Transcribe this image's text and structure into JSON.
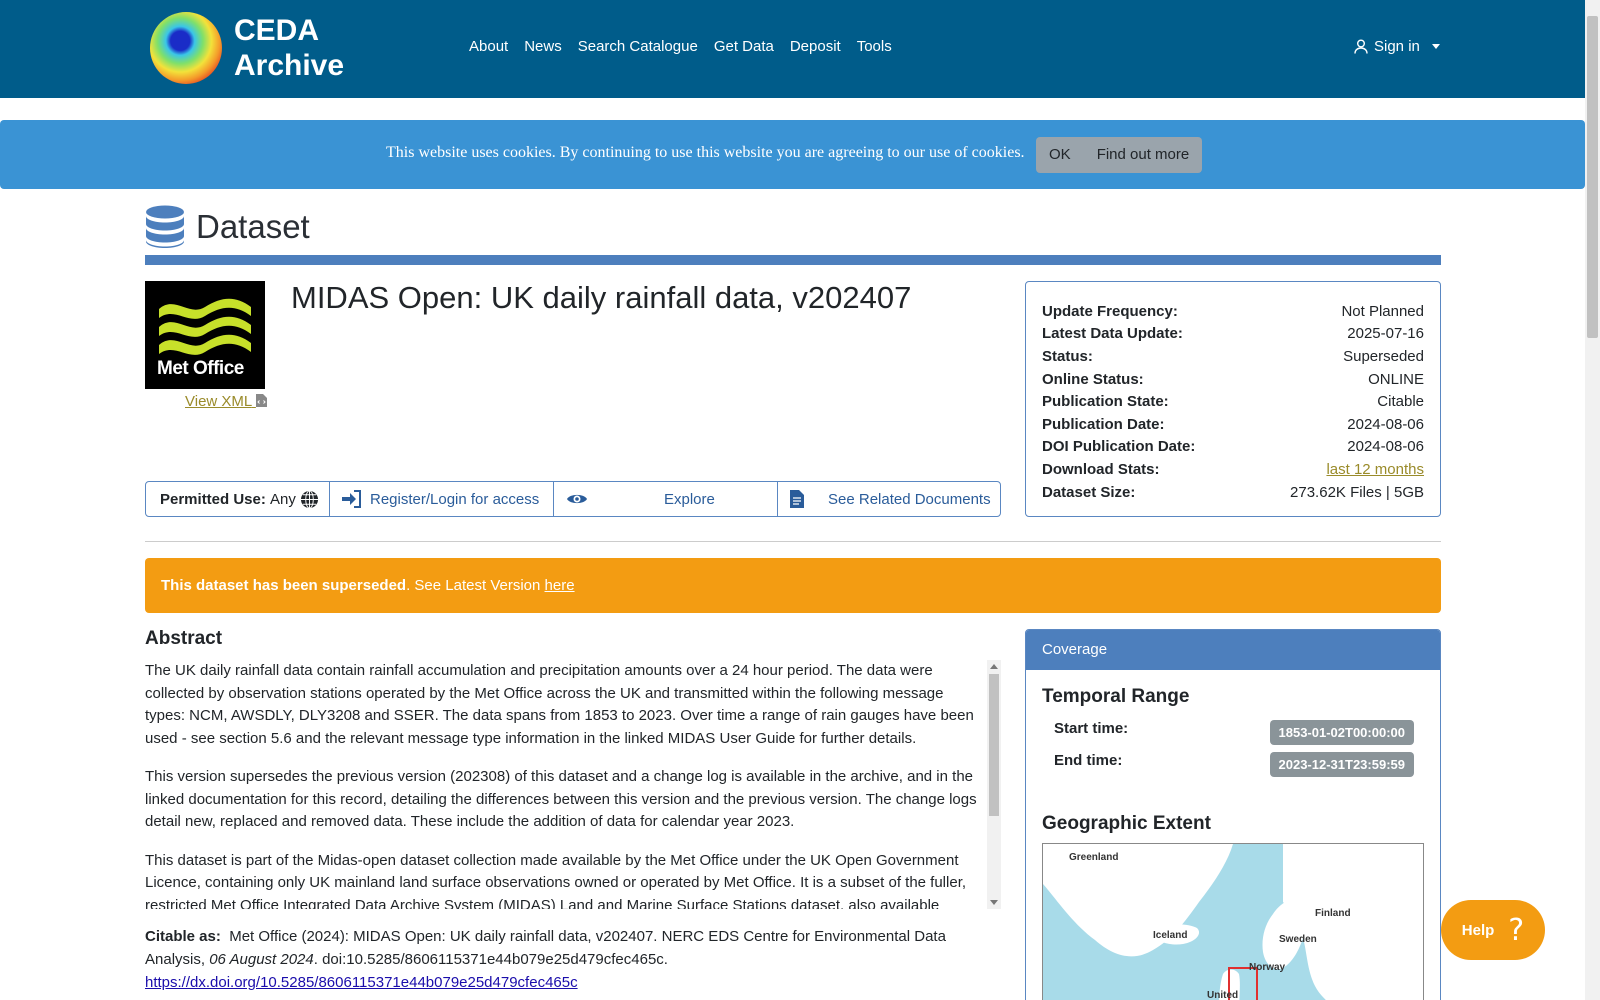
{
  "nav": {
    "brand_line1": "CEDA",
    "brand_line2": "Archive",
    "items": [
      "About",
      "News",
      "Search Catalogue",
      "Get Data",
      "Deposit",
      "Tools"
    ],
    "signin": "Sign in"
  },
  "cookie": {
    "text": "This website uses cookies. By continuing to use this website you are agreeing to our use of cookies.",
    "ok": "OK",
    "find_out": "Find out more"
  },
  "header": {
    "title": "Dataset"
  },
  "logo_text": "Met Office",
  "view_xml": "View XML",
  "dataset_title": "MIDAS Open: UK daily rainfall data, v202407",
  "actions": {
    "permitted_label": "Permitted Use:",
    "permitted_value": "Any",
    "register": "Register/Login for access",
    "explore": "Explore",
    "related": "See Related Documents"
  },
  "info": [
    {
      "k": "Update Frequency:",
      "v": "Not Planned"
    },
    {
      "k": "Latest Data Update:",
      "v": "2025-07-16"
    },
    {
      "k": "Status:",
      "v": "Superseded"
    },
    {
      "k": "Online Status:",
      "v": "ONLINE"
    },
    {
      "k": "Publication State:",
      "v": "Citable"
    },
    {
      "k": "Publication Date:",
      "v": "2024-08-06"
    },
    {
      "k": "DOI Publication Date:",
      "v": "2024-08-06"
    },
    {
      "k": "Download Stats:",
      "v": "last 12 months"
    },
    {
      "k": "Dataset Size:",
      "v": "273.62K Files | 5GB"
    }
  ],
  "warning": {
    "bold": "This dataset has been superseded",
    "rest": ". See Latest Version ",
    "link": "here"
  },
  "abstract": {
    "heading": "Abstract",
    "paragraphs": [
      "The UK daily rainfall data contain rainfall accumulation and precipitation amounts over a 24 hour period. The data were collected by observation stations operated by the Met Office across the UK and transmitted within the following message types: NCM, AWSDLY, DLY3208 and SSER. The data spans from 1853 to 2023. Over time a range of rain gauges have been used - see section 5.6 and the relevant message type information in the linked MIDAS User Guide for further details.",
      "This version supersedes the previous version (202308) of this dataset and a change log is available in the archive, and in the linked documentation for this record, detailing the differences between this version and the previous version. The change logs detail new, replaced and removed data. These include the addition of data for calendar year 2023.",
      "This dataset is part of the Midas-open dataset collection made available by the Met Office under the UK Open Government Licence, containing only UK mainland land surface observations owned or operated by Met Office. It is a subset of the fuller, restricted Met Office Integrated Data Archive System (MIDAS) Land and Marine Surface Stations dataset, also available"
    ]
  },
  "citation": {
    "label": "Citable as:",
    "text": "Met Office (2024): MIDAS Open: UK daily rainfall data, v202407. NERC EDS Centre for Environmental Data Analysis,",
    "date": "06 August 2024",
    "doi": ". doi:10.5285/8606115371e44b079e25d479cfec465c.",
    "url": "https://dx.doi.org/10.5285/8606115371e44b079e25d479cfec465c"
  },
  "coverage": {
    "header": "Coverage",
    "temporal_heading": "Temporal Range",
    "start_label": "Start time:",
    "start_value": "1853-01-02T00:00:00",
    "end_label": "End time:",
    "end_value": "2023-12-31T23:59:59",
    "geo_heading": "Geographic Extent",
    "map_labels": [
      "Greenland",
      "Iceland",
      "Finland",
      "Sweden",
      "Norway",
      "United"
    ]
  },
  "help": "Help",
  "colors": {
    "navbar": "#005c8a",
    "cookie": "#3a93d4",
    "accent": "#4d7fbd",
    "warning": "#f39c12"
  }
}
